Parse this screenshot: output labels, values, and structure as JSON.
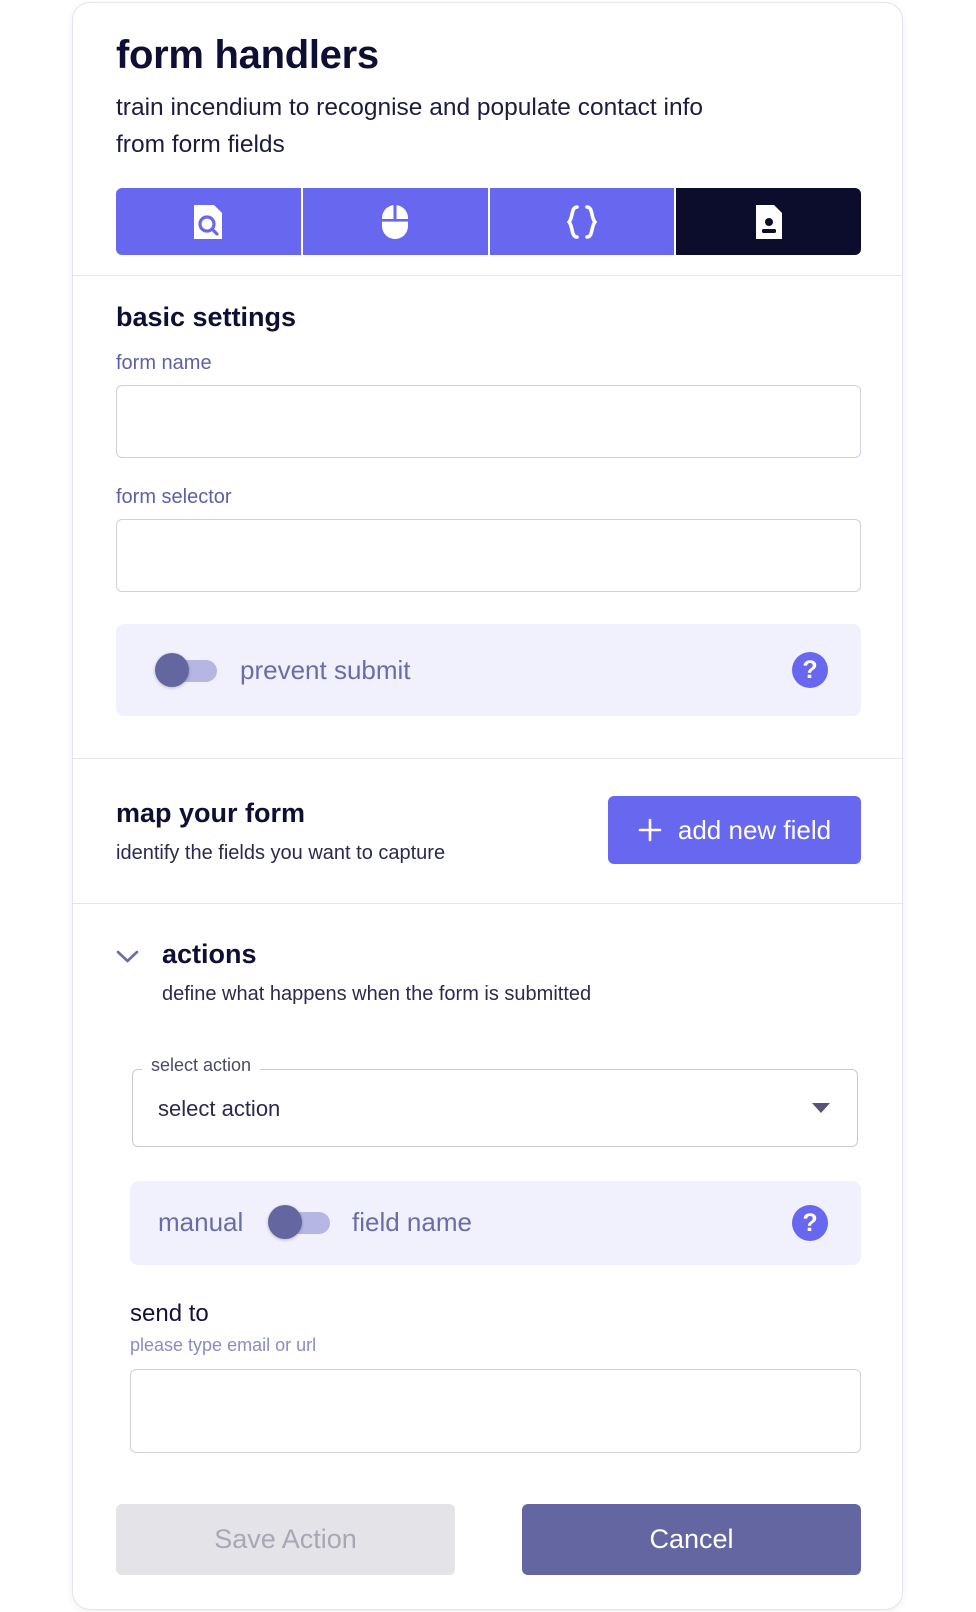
{
  "header": {
    "title": "form handlers",
    "subtitle": "train incendium to recognise and populate contact info from form fields"
  },
  "tabs": [
    {
      "icon": "file-search-icon",
      "active": false
    },
    {
      "icon": "mouse-icon",
      "active": false
    },
    {
      "icon": "curly-braces-icon",
      "active": false
    },
    {
      "icon": "contact-file-icon",
      "active": true
    }
  ],
  "basic_settings": {
    "heading": "basic settings",
    "form_name_label": "form name",
    "form_name_value": "",
    "form_selector_label": "form selector",
    "form_selector_value": "",
    "prevent_submit_label": "prevent submit",
    "prevent_submit_on": false,
    "help_glyph": "?"
  },
  "map_form": {
    "heading": "map your form",
    "description": "identify the fields you want to capture",
    "add_button_label": "add new field"
  },
  "actions": {
    "heading": "actions",
    "description": "define what happens when the form is submitted",
    "select_legend": "select action",
    "select_value": "select action",
    "manual_label": "manual",
    "field_name_label": "field name",
    "mode_toggle_on": false,
    "help_glyph": "?",
    "send_to_label": "send to",
    "send_to_hint": "please type email or url",
    "send_to_value": ""
  },
  "footer": {
    "save_label": "Save Action",
    "cancel_label": "Cancel"
  },
  "colors": {
    "accent": "#6767ef",
    "dark": "#0c0c2c",
    "muted_label": "#5d60a8",
    "panel_bg": "#f1f1fd",
    "cancel_bg": "#6466a2",
    "save_disabled_bg": "#e3e3e8"
  }
}
